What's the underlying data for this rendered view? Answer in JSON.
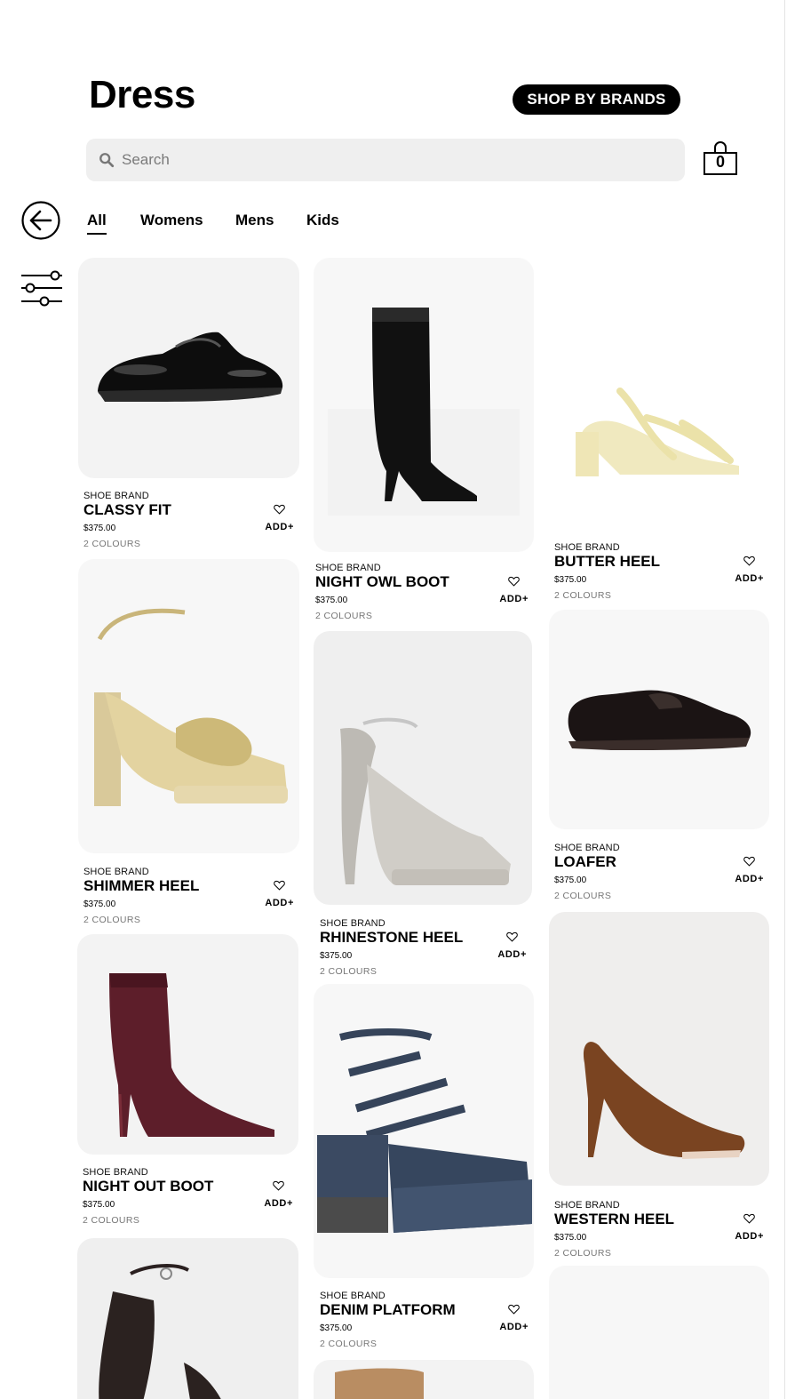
{
  "header": {
    "title": "Dress",
    "brands_button": "SHOP BY BRANDS"
  },
  "search": {
    "placeholder": "Search"
  },
  "cart": {
    "count": "0"
  },
  "tabs": [
    "All",
    "Womens",
    "Mens",
    "Kids"
  ],
  "active_tab": "All",
  "products": [
    {
      "brand": "SHOE BRAND",
      "name": "CLASSY FIT",
      "price": "$375.00",
      "colours": "2 COLOURS",
      "add": "ADD+"
    },
    {
      "brand": "SHOE BRAND",
      "name": "NIGHT OWL BOOT",
      "price": "$375.00",
      "colours": "2 COLOURS",
      "add": "ADD+"
    },
    {
      "brand": "SHOE BRAND",
      "name": "BUTTER HEEL",
      "price": "$375.00",
      "colours": "2 COLOURS",
      "add": "ADD+"
    },
    {
      "brand": "SHOE BRAND",
      "name": "SHIMMER HEEL",
      "price": "$375.00",
      "colours": "2 COLOURS",
      "add": "ADD+"
    },
    {
      "brand": "SHOE BRAND",
      "name": "RHINESTONE HEEL",
      "price": "$375.00",
      "colours": "2 COLOURS",
      "add": "ADD+"
    },
    {
      "brand": "SHOE BRAND",
      "name": "LOAFER",
      "price": "$375.00",
      "colours": "2 COLOURS",
      "add": "ADD+"
    },
    {
      "brand": "SHOE BRAND",
      "name": "NIGHT OUT BOOT",
      "price": "$375.00",
      "colours": "2 COLOURS",
      "add": "ADD+"
    },
    {
      "brand": "SHOE BRAND",
      "name": "DENIM PLATFORM",
      "price": "$375.00",
      "colours": "2 COLOURS",
      "add": "ADD+"
    },
    {
      "brand": "SHOE BRAND",
      "name": "WESTERN HEEL",
      "price": "$375.00",
      "colours": "2 COLOURS",
      "add": "ADD+"
    }
  ]
}
